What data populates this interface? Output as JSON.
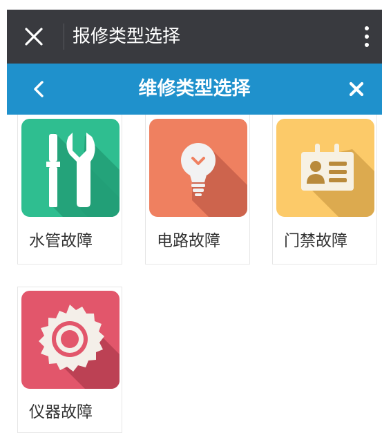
{
  "titlebar": {
    "title": "报修类型选择"
  },
  "navbar": {
    "title": "维修类型选择"
  },
  "colors": {
    "titlebar_bg": "#393a3f",
    "navbar_bg": "#1f91cc",
    "water": "#2fbe90",
    "circuit": "#ef8060",
    "access": "#fcca69",
    "instrument": "#e2566b"
  },
  "categories": [
    {
      "label": "水管故障",
      "icon": "wrench-screwdriver-icon"
    },
    {
      "label": "电路故障",
      "icon": "lightbulb-icon"
    },
    {
      "label": "门禁故障",
      "icon": "id-badge-icon"
    },
    {
      "label": "仪器故障",
      "icon": "saw-blade-icon"
    }
  ]
}
